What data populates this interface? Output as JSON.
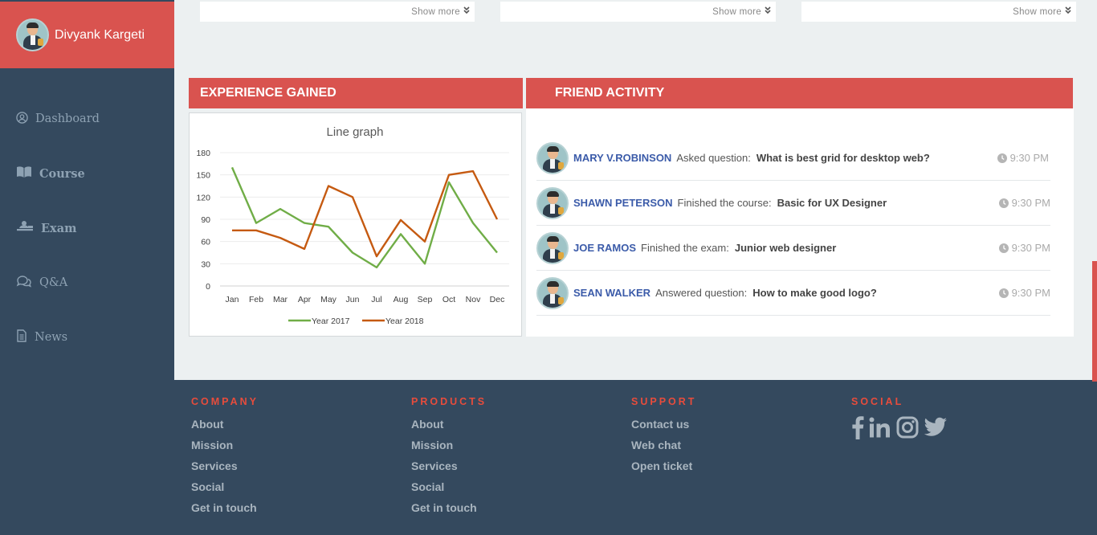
{
  "profile": {
    "name": "Divyank Kargeti"
  },
  "sidebar": {
    "items": [
      {
        "label": "Dashboard",
        "icon": "user-circle-icon"
      },
      {
        "label": "Course",
        "icon": "book-icon"
      },
      {
        "label": "Exam",
        "icon": "exam-icon"
      },
      {
        "label": "Q&A",
        "icon": "chat-icon"
      },
      {
        "label": "News",
        "icon": "document-icon"
      }
    ]
  },
  "top_cards": [
    {
      "show_more": "Show more"
    },
    {
      "show_more": "Show more"
    },
    {
      "show_more": "Show more"
    }
  ],
  "experience": {
    "title": "EXPERIENCE GAINED"
  },
  "chart_data": {
    "type": "line",
    "title": "Line graph",
    "categories": [
      "Jan",
      "Feb",
      "Mar",
      "Apr",
      "May",
      "Jun",
      "Jul",
      "Aug",
      "Sep",
      "Oct",
      "Nov",
      "Dec"
    ],
    "series": [
      {
        "name": "Year 2017",
        "color": "#70ad47",
        "values": [
          160,
          85,
          104,
          85,
          80,
          45,
          25,
          70,
          30,
          140,
          85,
          45
        ]
      },
      {
        "name": "Year 2018",
        "color": "#c55a11",
        "values": [
          75,
          75,
          65,
          50,
          135,
          120,
          40,
          89,
          60,
          150,
          155,
          90
        ]
      }
    ],
    "yticks": [
      0,
      30,
      60,
      90,
      120,
      150,
      180
    ],
    "ylim": [
      0,
      180
    ],
    "grid": true,
    "legend": "bottom"
  },
  "friend_activity": {
    "title": "FRIEND ACTIVITY",
    "items": [
      {
        "name": "MARY V.ROBINSON",
        "verb": "Asked question:",
        "object": "What is best grid for desktop web?",
        "time": "9:30 PM"
      },
      {
        "name": "SHAWN PETERSON",
        "verb": "Finished the course:",
        "object": "Basic for UX Designer",
        "time": "9:30 PM"
      },
      {
        "name": "JOE RAMOS",
        "verb": "Finished the exam:",
        "object": "Junior web designer",
        "time": "9:30 PM"
      },
      {
        "name": "SEAN WALKER",
        "verb": "Answered question:",
        "object": "How to make good logo?",
        "time": "9:30 PM"
      }
    ]
  },
  "footer": {
    "columns": [
      {
        "heading": "COMPANY",
        "links": [
          "About",
          "Mission",
          "Services",
          "Social",
          "Get in touch"
        ]
      },
      {
        "heading": "PRODUCTS",
        "links": [
          "About",
          "Mission",
          "Services",
          "Social",
          "Get in touch"
        ]
      },
      {
        "heading": "SUPPORT",
        "links": [
          "Contact us",
          "Web chat",
          "Open ticket"
        ]
      }
    ],
    "social": {
      "heading": "SOCIAL",
      "icons": [
        "facebook-icon",
        "linkedin-icon",
        "instagram-icon",
        "twitter-icon"
      ]
    }
  }
}
